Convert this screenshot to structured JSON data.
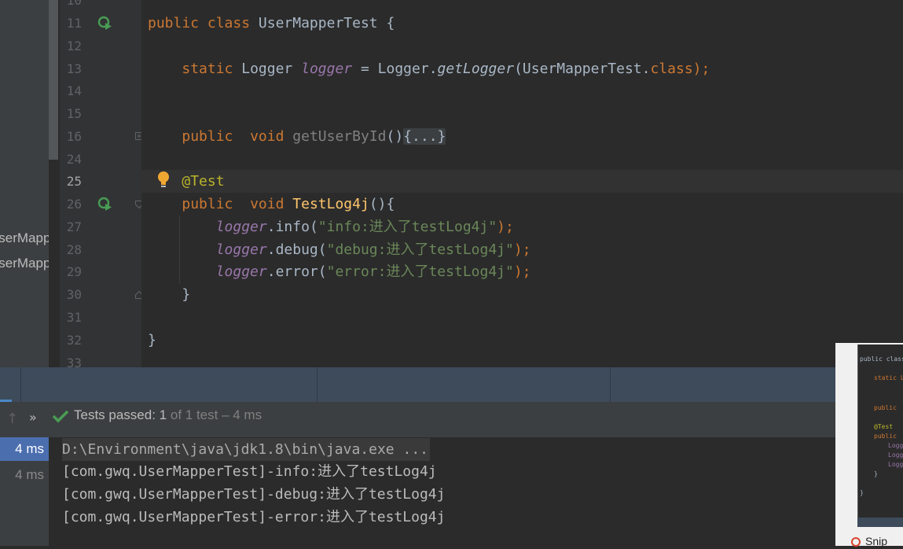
{
  "project_tree": {
    "items": [
      "UserMapper",
      "UserMapper.xml"
    ]
  },
  "editor": {
    "line_numbers": [
      "10",
      "11",
      "12",
      "13",
      "14",
      "15",
      "16",
      "24",
      "25",
      "26",
      "27",
      "28",
      "29",
      "30",
      "31",
      "32",
      "33"
    ],
    "class_decl": {
      "kw1": "public",
      "kw2": "class",
      "name": "UserMapperTest",
      "brace": "{"
    },
    "logger_decl": {
      "kw": "static",
      "type": "Logger",
      "field": "logger",
      "eq": "=",
      "recv": "Logger.",
      "method": "getLogger",
      "open": "(",
      "arg": "UserMapperTest.",
      "argkw": "class",
      "close": ");"
    },
    "folded_method": {
      "kw1": "public",
      "kw2": "void",
      "name": "getUserById",
      "parens": "()",
      "placeholder": "{...}"
    },
    "annotation": "@Test",
    "test_method": {
      "kw1": "public",
      "kw2": "void",
      "name": "TestLog4j",
      "tail": "(){"
    },
    "calls": [
      {
        "field": "logger",
        "dot": ".",
        "method": "info",
        "open": "(",
        "arg": "\"info:进入了testLog4j\"",
        "close": ");"
      },
      {
        "field": "logger",
        "dot": ".",
        "method": "debug",
        "open": "(",
        "arg": "\"debug:进入了testLog4j\"",
        "close": ");"
      },
      {
        "field": "logger",
        "dot": ".",
        "method": "error",
        "open": "(",
        "arg": "\"error:进入了testLog4j\"",
        "close": ");"
      }
    ],
    "method_close": "}",
    "class_close": "}"
  },
  "run": {
    "up_icon": "arrow-up-icon",
    "expand_icon": "double-chevron-icon",
    "status_icon": "check-icon",
    "status_prefix": "Tests passed: ",
    "passed": "1",
    "rest": " of 1 test – 4 ms",
    "times": [
      "4 ms",
      "4 ms"
    ],
    "console": [
      "D:\\Environment\\java\\jdk1.8\\bin\\java.exe ...",
      "[com.gwq.UserMapperTest]-info:进入了testLog4j",
      "[com.gwq.UserMapperTest]-debug:进入了testLog4j",
      "[com.gwq.UserMapperTest]-error:进入了testLog4j"
    ]
  },
  "thumbnail": {
    "lines": [
      "public class",
      "static L",
      "public",
      "@Test",
      "public",
      "Logg",
      "Logg",
      "Logg",
      "}",
      "}"
    ]
  },
  "taskbar": {
    "snip_label": "Snip"
  },
  "colors": {
    "keyword": "#cc7832",
    "method": "#ffc66d",
    "field": "#9876aa",
    "string": "#6a8759",
    "annotation": "#bbb529",
    "pass_green": "#499c54",
    "selection": "#4b6eaf"
  }
}
